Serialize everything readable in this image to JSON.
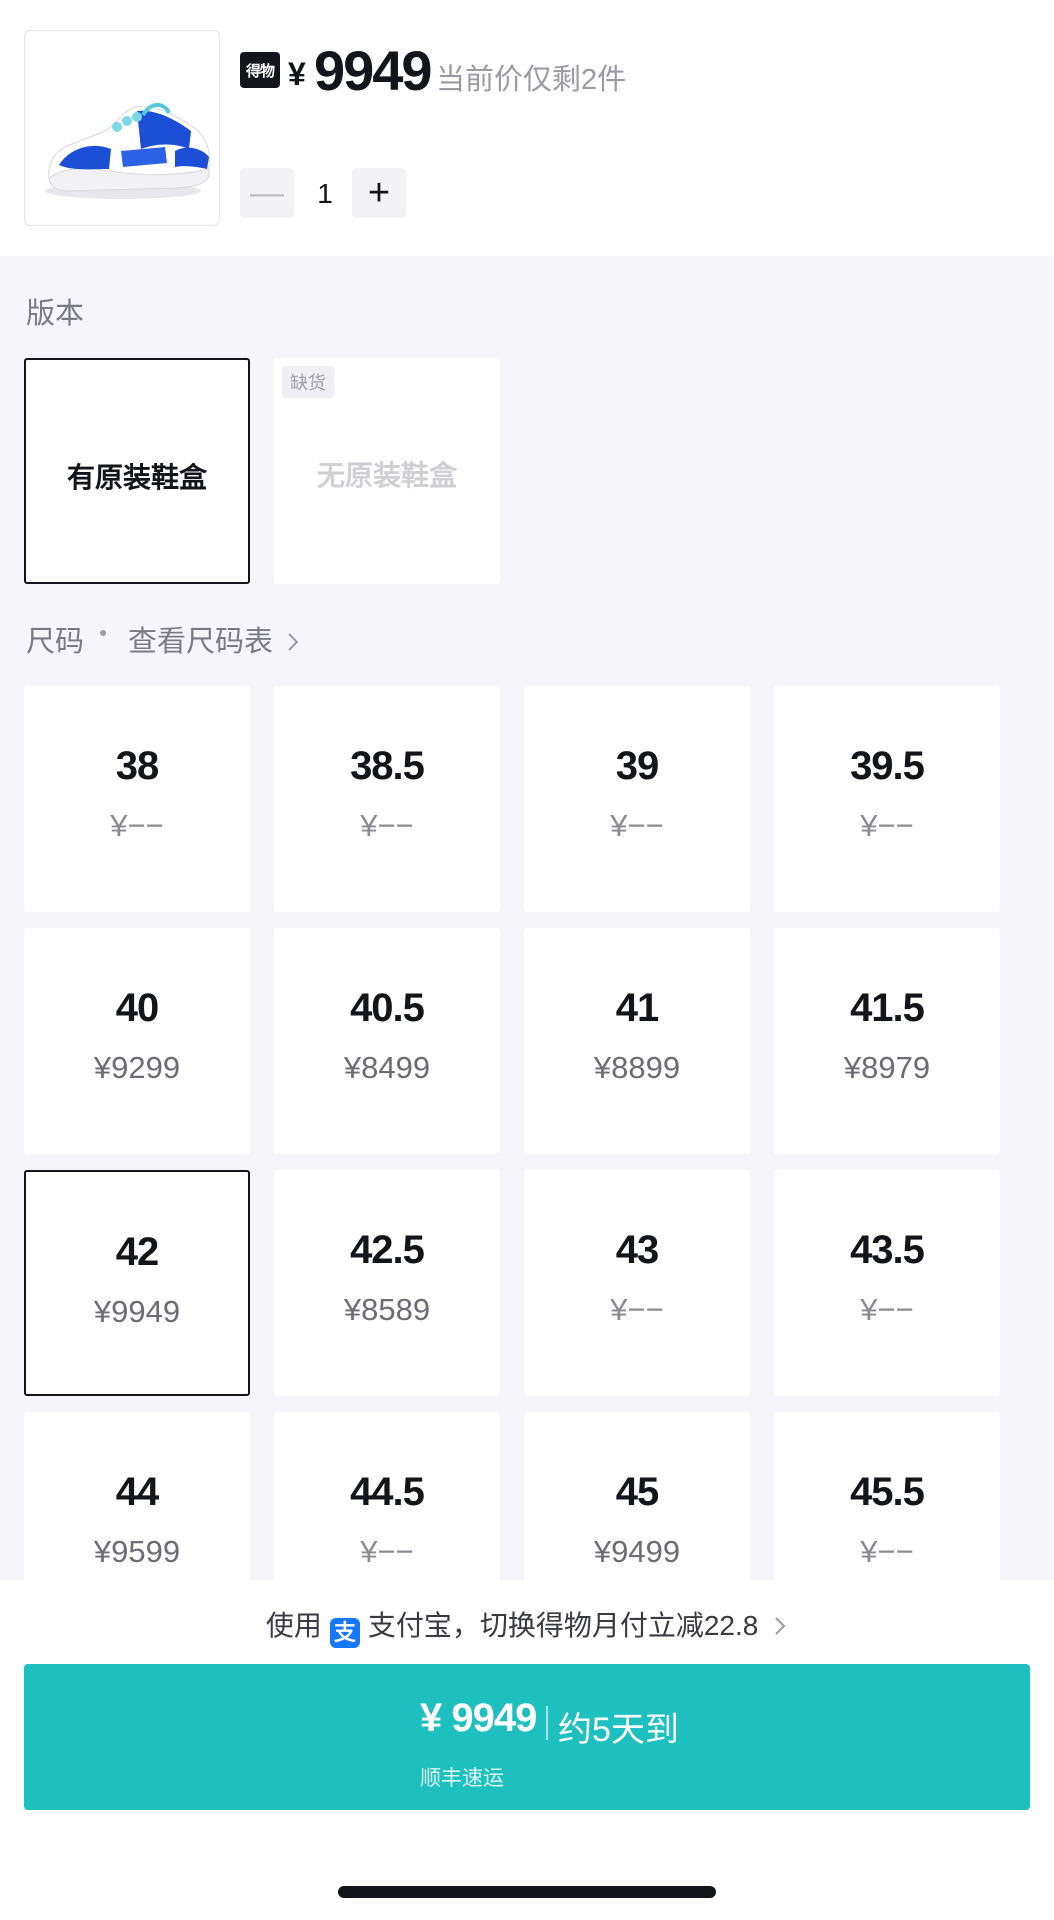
{
  "header": {
    "brand_logo": "得物",
    "currency": "¥",
    "price": "9949",
    "stock_note": "当前价仅剩2件",
    "quantity": "1",
    "minus_symbol": "—",
    "plus_symbol": "+"
  },
  "version": {
    "label": "版本",
    "options": [
      {
        "title": "有原装鞋盒",
        "selected": true,
        "badge": ""
      },
      {
        "title": "无原装鞋盒",
        "selected": false,
        "badge": "缺货"
      }
    ]
  },
  "size": {
    "label": "尺码",
    "chart_link": "查看尺码表",
    "options": [
      {
        "size": "38",
        "price": "¥−−"
      },
      {
        "size": "38.5",
        "price": "¥−−"
      },
      {
        "size": "39",
        "price": "¥−−"
      },
      {
        "size": "39.5",
        "price": "¥−−"
      },
      {
        "size": "40",
        "price": "¥9299"
      },
      {
        "size": "40.5",
        "price": "¥8499"
      },
      {
        "size": "41",
        "price": "¥8899"
      },
      {
        "size": "41.5",
        "price": "¥8979"
      },
      {
        "size": "42",
        "price": "¥9949",
        "selected": true
      },
      {
        "size": "42.5",
        "price": "¥8589"
      },
      {
        "size": "43",
        "price": "¥−−"
      },
      {
        "size": "43.5",
        "price": "¥−−"
      },
      {
        "size": "44",
        "price": "¥9599"
      },
      {
        "size": "44.5",
        "price": "¥−−"
      },
      {
        "size": "45",
        "price": "¥9499"
      },
      {
        "size": "45.5",
        "price": "¥−−"
      }
    ]
  },
  "promo": {
    "prefix": "使用",
    "icon_glyph": "支",
    "text": "支付宝，切换得物月付立减22.8"
  },
  "buy": {
    "price": "¥ 9949",
    "eta": "约5天到",
    "shipping": "顺丰速运"
  },
  "colors": {
    "accent": "#1ebfbf",
    "alipay": "#1677ff",
    "selected_border": "#14151a"
  }
}
